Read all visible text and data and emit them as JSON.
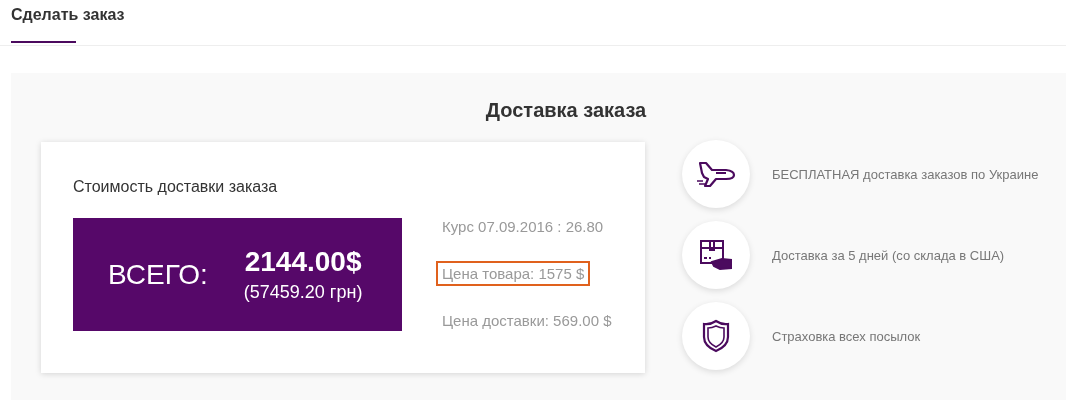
{
  "tabs": [
    {
      "label": "Сделать заказ",
      "selected": true
    }
  ],
  "section": {
    "title": "Доставка заказа",
    "card": {
      "title": "Стоимость доставки заказа",
      "total_label": "ВСЕГО:",
      "total_usd": "2144.00$",
      "total_uah": "(57459.20 грн)",
      "details": [
        {
          "text": "Курс 07.09.2016 : 26.80",
          "highlighted": false
        },
        {
          "text": "Цена товара: 1575 $",
          "highlighted": true
        },
        {
          "text": "Цена доставки: 569.00 $",
          "highlighted": false
        }
      ]
    },
    "features": [
      {
        "kind": "plane",
        "text": "БЕСПЛАТНАЯ доставка заказов по Украине"
      },
      {
        "kind": "box",
        "text": "Доставка за 5 дней (со склада в США)"
      },
      {
        "kind": "shield",
        "text": "Страховка всех посылок"
      }
    ]
  }
}
